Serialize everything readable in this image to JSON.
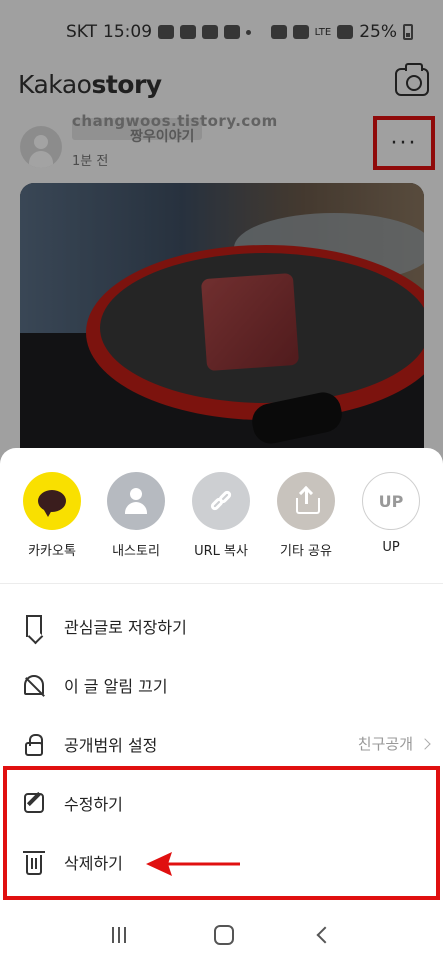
{
  "status": {
    "carrier": "SKT",
    "time": "15:09",
    "network": "LTE",
    "battery": "25%"
  },
  "app": {
    "logo_light": "Kakao",
    "logo_bold": "story"
  },
  "post": {
    "watermark": "changwoos.tistory.com",
    "author": "짱우이야기",
    "time_ago": "1분 전",
    "more_label": "···"
  },
  "share": {
    "items": [
      {
        "label": "카카오톡",
        "icon": "kakaotalk-icon",
        "color": "#f9e000"
      },
      {
        "label": "내스토리",
        "icon": "person-icon",
        "color": "#b6bac0"
      },
      {
        "label": "URL 복사",
        "icon": "link-icon",
        "color": "#cdcfd2"
      },
      {
        "label": "기타 공유",
        "icon": "share-icon",
        "color": "#c8c3bd"
      },
      {
        "label": "UP",
        "icon_text": "UP",
        "icon": "up-icon",
        "color": "#ffffff"
      }
    ]
  },
  "menu": {
    "items": [
      {
        "label": "관심글로 저장하기",
        "icon": "bookmark-icon"
      },
      {
        "label": "이 글 알림 끄기",
        "icon": "bell-off-icon"
      },
      {
        "label": "공개범위 설정",
        "icon": "lock-icon",
        "value": "친구공개"
      },
      {
        "label": "수정하기",
        "icon": "edit-icon"
      },
      {
        "label": "삭제하기",
        "icon": "trash-icon"
      }
    ]
  },
  "accent": "#e01010"
}
